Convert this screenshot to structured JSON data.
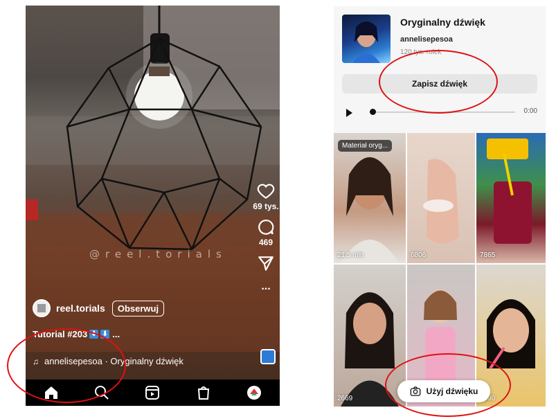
{
  "left_screen": {
    "watermark": "@reel.torials",
    "likes": "69 tys.",
    "comments": "469",
    "more": "...",
    "username": "reel.torials",
    "follow_label": "Obserwuj",
    "caption": "Tutorial #203",
    "caption_suffix": "...",
    "audio_line": "annelisepesoa · Oryginalny dźwięk",
    "icons": [
      "heart-icon",
      "comment-icon",
      "send-icon",
      "music-note-icon",
      "home-icon",
      "search-icon",
      "reels-icon",
      "shop-icon",
      "profile-avatar"
    ]
  },
  "right_screen": {
    "sound_title": "Oryginalny dźwięk",
    "author": "annelisepesoa",
    "reel_count": "120 tys. rolek",
    "save_label": "Zapisz dźwięk",
    "time": "0:00",
    "playback_progress": 0,
    "tag_label": "Materiał oryg...",
    "tiles": [
      {
        "count": "21,5 mln"
      },
      {
        "count": "6806"
      },
      {
        "count": "7865"
      },
      {
        "count": "2669"
      },
      {
        "count": ""
      },
      {
        "count": "1490"
      }
    ],
    "use_label": "Użyj dźwięku"
  },
  "colors": {
    "annotation": "#e01010",
    "save_button_bg": "#e6e6e6",
    "nav_bg": "#000000"
  }
}
